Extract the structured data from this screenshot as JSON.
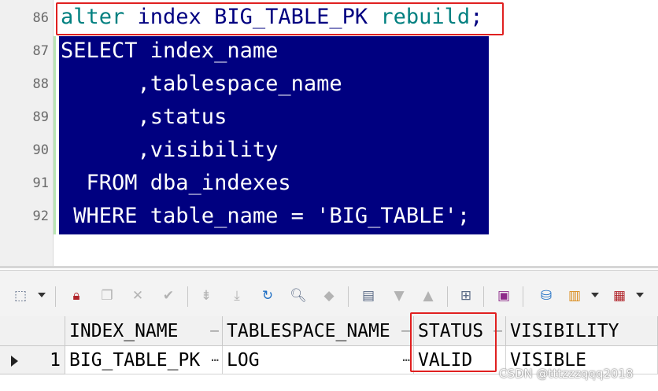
{
  "editor": {
    "line_numbers": [
      "86",
      "87",
      "88",
      "89",
      "90",
      "91",
      "92"
    ],
    "lines": [
      {
        "kw1": "alter",
        "mid": " index BIG_TABLE_PK ",
        "kw2": "rebuild",
        "end": ";"
      },
      {
        "text": "SELECT index_name"
      },
      {
        "text": "      ,tablespace_name"
      },
      {
        "text": "      ,status"
      },
      {
        "text": "      ,visibility"
      },
      {
        "text": "  FROM dba_indexes"
      },
      {
        "text": " WHERE table_name = 'BIG_TABLE';"
      }
    ],
    "colors": {
      "selection": "#000080",
      "keyword": "#008080",
      "identifier": "#000080",
      "highlight_box": "#e02020"
    }
  },
  "toolbar": {
    "icons": [
      "grid-select-icon",
      "lock-icon",
      "new-record-icon",
      "delete-record-icon",
      "post-edit-icon",
      "first-record-icon",
      "last-record-icon",
      "refresh-icon",
      "find-icon",
      "clear-icon",
      "query-by-example-icon",
      "previous-icon",
      "next-icon",
      "record-view-icon",
      "save-icon",
      "export-icon",
      "chart-icon",
      "grid-options-icon"
    ]
  },
  "grid": {
    "columns": [
      "INDEX_NAME",
      "TABLESPACE_NAME",
      "STATUS",
      "VISIBILITY"
    ],
    "rows": [
      {
        "num": "1",
        "index_name": "BIG_TABLE_PK",
        "tablespace_name": "LOG",
        "status": "VALID",
        "visibility": "VISIBLE"
      }
    ]
  },
  "watermark": "CSDN @tttzzzqqq2018"
}
